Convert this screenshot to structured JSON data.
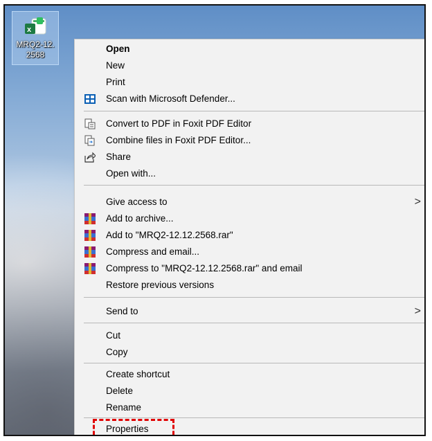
{
  "desktop": {
    "file_icon": {
      "name_line1": "MRQ2-12.",
      "name_line2": "2568",
      "icon": "excel-file-icon"
    }
  },
  "menu": {
    "items": [
      {
        "label": "Open"
      },
      {
        "label": "New"
      },
      {
        "label": "Print"
      },
      {
        "label": "Scan with Microsoft Defender...",
        "icon": "defender-shield-icon"
      },
      {
        "label": "Convert to PDF in Foxit PDF Editor",
        "icon": "foxit-convert-icon"
      },
      {
        "label": "Combine files in Foxit PDF Editor...",
        "icon": "foxit-combine-icon"
      },
      {
        "label": "Share",
        "icon": "share-icon"
      },
      {
        "label": "Open with..."
      },
      {
        "label": "Give access to",
        "arrow": ">"
      },
      {
        "label": "Add to archive...",
        "icon": "winrar-icon"
      },
      {
        "label": "Add to \"MRQ2-12.12.2568.rar\"",
        "icon": "winrar-icon"
      },
      {
        "label": "Compress and email...",
        "icon": "winrar-icon"
      },
      {
        "label": "Compress to \"MRQ2-12.12.2568.rar\" and email",
        "icon": "winrar-icon"
      },
      {
        "label": "Restore previous versions"
      },
      {
        "label": "Send to",
        "arrow": ">"
      },
      {
        "label": "Cut"
      },
      {
        "label": "Copy"
      },
      {
        "label": "Create shortcut"
      },
      {
        "label": "Delete"
      },
      {
        "label": "Rename"
      },
      {
        "label": "Properties"
      }
    ]
  },
  "colors": {
    "menu_bg": "#f2f2f2",
    "highlight": "#e00000",
    "defender": "#0a5fb4",
    "excel": "#1d7a43"
  }
}
